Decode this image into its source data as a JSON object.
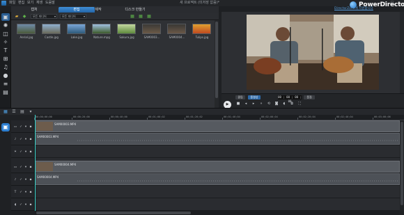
{
  "menu": {
    "items": [
      "파일",
      "편집",
      "보기",
      "재생",
      "도움말"
    ],
    "project_title": "새 프로젝트 (미저장 없음)*",
    "window_buttons": [
      "–",
      "□",
      "×"
    ]
  },
  "brand": {
    "upgrade_link": "DirectorZone에 지원합니다",
    "name": "PowerDirector"
  },
  "library": {
    "tabs": [
      "캡처",
      "편집",
      "제작",
      "디스크 만들기"
    ],
    "active_tab": 1,
    "filter_dropdown": "모든 미디어",
    "sort_dropdown": "모든 미디어",
    "items": [
      {
        "name": "Aerial.jpg",
        "color_top": "#6e8aa8",
        "color_bottom": "#4b5a3a"
      },
      {
        "name": "Castle.jpg",
        "color_top": "#8fb0d0",
        "color_bottom": "#6a6a5a"
      },
      {
        "name": "Lake.jpg",
        "color_top": "#7aa6d8",
        "color_bottom": "#2e5a7a"
      },
      {
        "name": "Nature.mpg",
        "color_top": "#a0c0e0",
        "color_bottom": "#3d5a2a"
      },
      {
        "name": "Sakura.jpg",
        "color_top": "#c4d8a0",
        "color_bottom": "#5e8a3c"
      },
      {
        "name": "SAM0003...",
        "color_top": "#3c3a36",
        "color_bottom": "#6b5a48"
      },
      {
        "name": "SAM0004...",
        "color_top": "#3a3834",
        "color_bottom": "#6a5848"
      },
      {
        "name": "Tulips.jpg",
        "color_top": "#e0a030",
        "color_bottom": "#c04a20"
      }
    ]
  },
  "preview": {
    "clip_label": "클립",
    "movie_label": "동영상",
    "timecode": "00 ; 00 ; 00 ; 00",
    "quality_label": "품질"
  },
  "timeline": {
    "ruler_labels": [
      "00;00;00;00",
      "00;00;20;00",
      "00;00;40;00",
      "00;01;00;02",
      "00;01;20;02",
      "00;01;40;04",
      "00;02;00;04",
      "00;02;20;04",
      "00;02;40;04",
      "00;03;00;06"
    ],
    "tracks": [
      {
        "type": "video",
        "clip": "SAM00003.MP4",
        "has_thumb": true
      },
      {
        "type": "audio",
        "clip": "SAM00003.MP4"
      },
      {
        "type": "fx",
        "clip": ""
      },
      {
        "type": "video",
        "clip": "SAM00004.MP4",
        "has_thumb": true
      },
      {
        "type": "audio",
        "clip": "SAM00004.MP4"
      },
      {
        "type": "title",
        "clip": ""
      },
      {
        "type": "voice",
        "clip": ""
      }
    ]
  }
}
